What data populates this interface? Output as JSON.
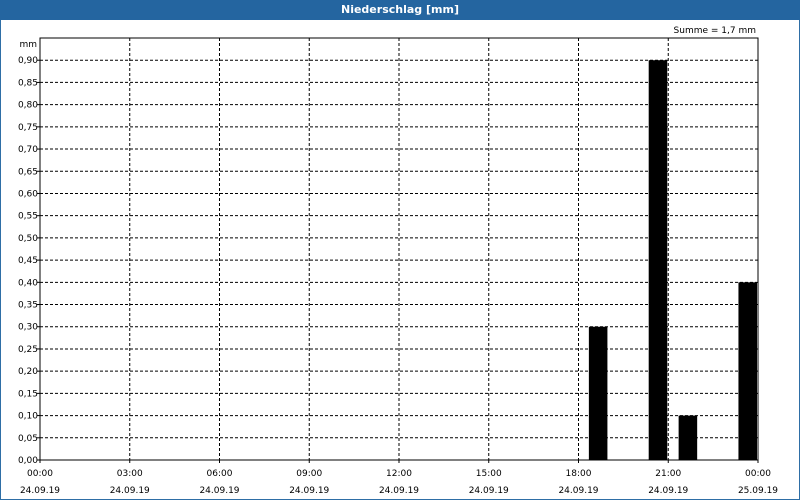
{
  "title": "Niederschlag [mm]",
  "summary": "Summe = 1,7 mm",
  "chart_data": {
    "type": "bar",
    "title": "Niederschlag [mm]",
    "ylabel": "mm",
    "xlabel": "",
    "ylim": [
      0,
      0.95
    ],
    "y_ticks": [
      "0,00",
      "0,05",
      "0,10",
      "0,15",
      "0,20",
      "0,25",
      "0,30",
      "0,35",
      "0,40",
      "0,45",
      "0,50",
      "0,55",
      "0,60",
      "0,65",
      "0,70",
      "0,75",
      "0,80",
      "0,85",
      "0,90"
    ],
    "x_ticks": [
      {
        "time": "00:00",
        "date": "24.09.19"
      },
      {
        "time": "03:00",
        "date": "24.09.19"
      },
      {
        "time": "06:00",
        "date": "24.09.19"
      },
      {
        "time": "09:00",
        "date": "24.09.19"
      },
      {
        "time": "12:00",
        "date": "24.09.19"
      },
      {
        "time": "15:00",
        "date": "24.09.19"
      },
      {
        "time": "18:00",
        "date": "24.09.19"
      },
      {
        "time": "21:00",
        "date": "24.09.19"
      },
      {
        "time": "00:00",
        "date": "25.09.19"
      }
    ],
    "xlim": [
      "24.09.19 00:00",
      "25.09.19 00:00"
    ],
    "grid": true,
    "bars": [
      {
        "time": "24.09.19 19:00",
        "value": 0.3
      },
      {
        "time": "24.09.19 21:00",
        "value": 0.9
      },
      {
        "time": "24.09.19 22:00",
        "value": 0.1
      },
      {
        "time": "25.09.19 00:00",
        "value": 0.4
      }
    ],
    "colors": {
      "bar": "#000000",
      "grid": "#000000"
    }
  }
}
